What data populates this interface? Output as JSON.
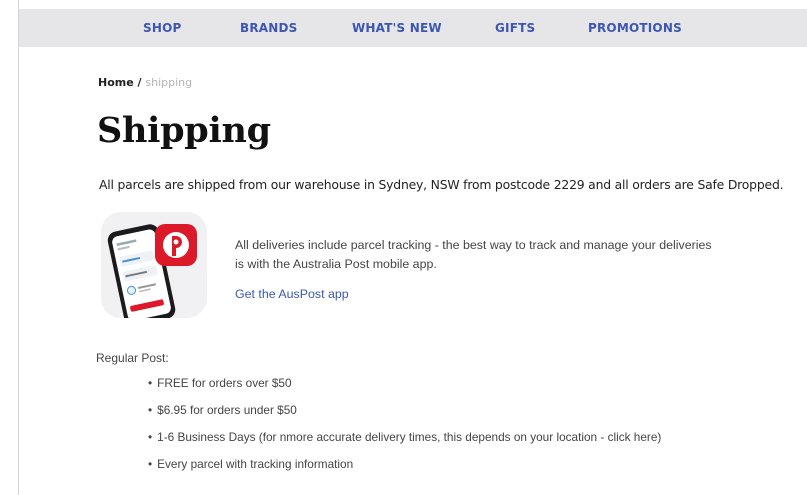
{
  "nav": {
    "items": [
      "SHOP",
      "BRANDS",
      "WHAT'S NEW",
      "GIFTS",
      "PROMOTIONS"
    ]
  },
  "breadcrumb": {
    "home": "Home",
    "separator": " / ",
    "current": "shipping"
  },
  "page": {
    "title": "Shipping",
    "intro": "All parcels are shipped from our warehouse in Sydney, NSW from postcode 2229 and all orders are Safe Dropped."
  },
  "app_promo": {
    "icon": "auspost-app-icon",
    "text": "All deliveries include parcel tracking - the best way to track and manage your deliveries is with the Australia Post mobile app.",
    "link_label": "Get the AusPost app"
  },
  "regular_post": {
    "heading": "Regular Post:",
    "bullets": [
      "FREE for orders over $50",
      "$6.95 for orders under $50",
      "1-6 Business Days (for nmore accurate delivery times, this depends on your location - click here)",
      "Every parcel with tracking information"
    ]
  },
  "colors": {
    "nav_bg": "#e6e6e8",
    "nav_text": "#3d56b2",
    "link": "#3d56b2",
    "auspost_red": "#dc1928"
  }
}
